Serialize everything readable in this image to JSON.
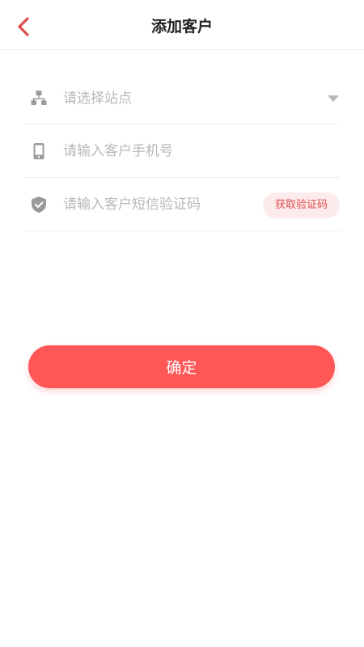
{
  "header": {
    "title": "添加客户",
    "back_icon": "chevron-left-icon"
  },
  "form": {
    "site": {
      "icon": "sitemap-icon",
      "placeholder": "请选择站点"
    },
    "phone": {
      "icon": "phone-icon",
      "placeholder": "请输入客户手机号"
    },
    "sms_code": {
      "icon": "shield-check-icon",
      "placeholder": "请输入客户短信验证码",
      "get_code_label": "获取验证码"
    }
  },
  "confirm_label": "确定",
  "colors": {
    "accent": "#ff5656",
    "back_arrow": "#e04b4b",
    "code_button_bg": "#fdeaea",
    "code_button_text": "#e0504f",
    "placeholder": "#b8b8b8",
    "icon_gray": "#9a9a9a"
  }
}
